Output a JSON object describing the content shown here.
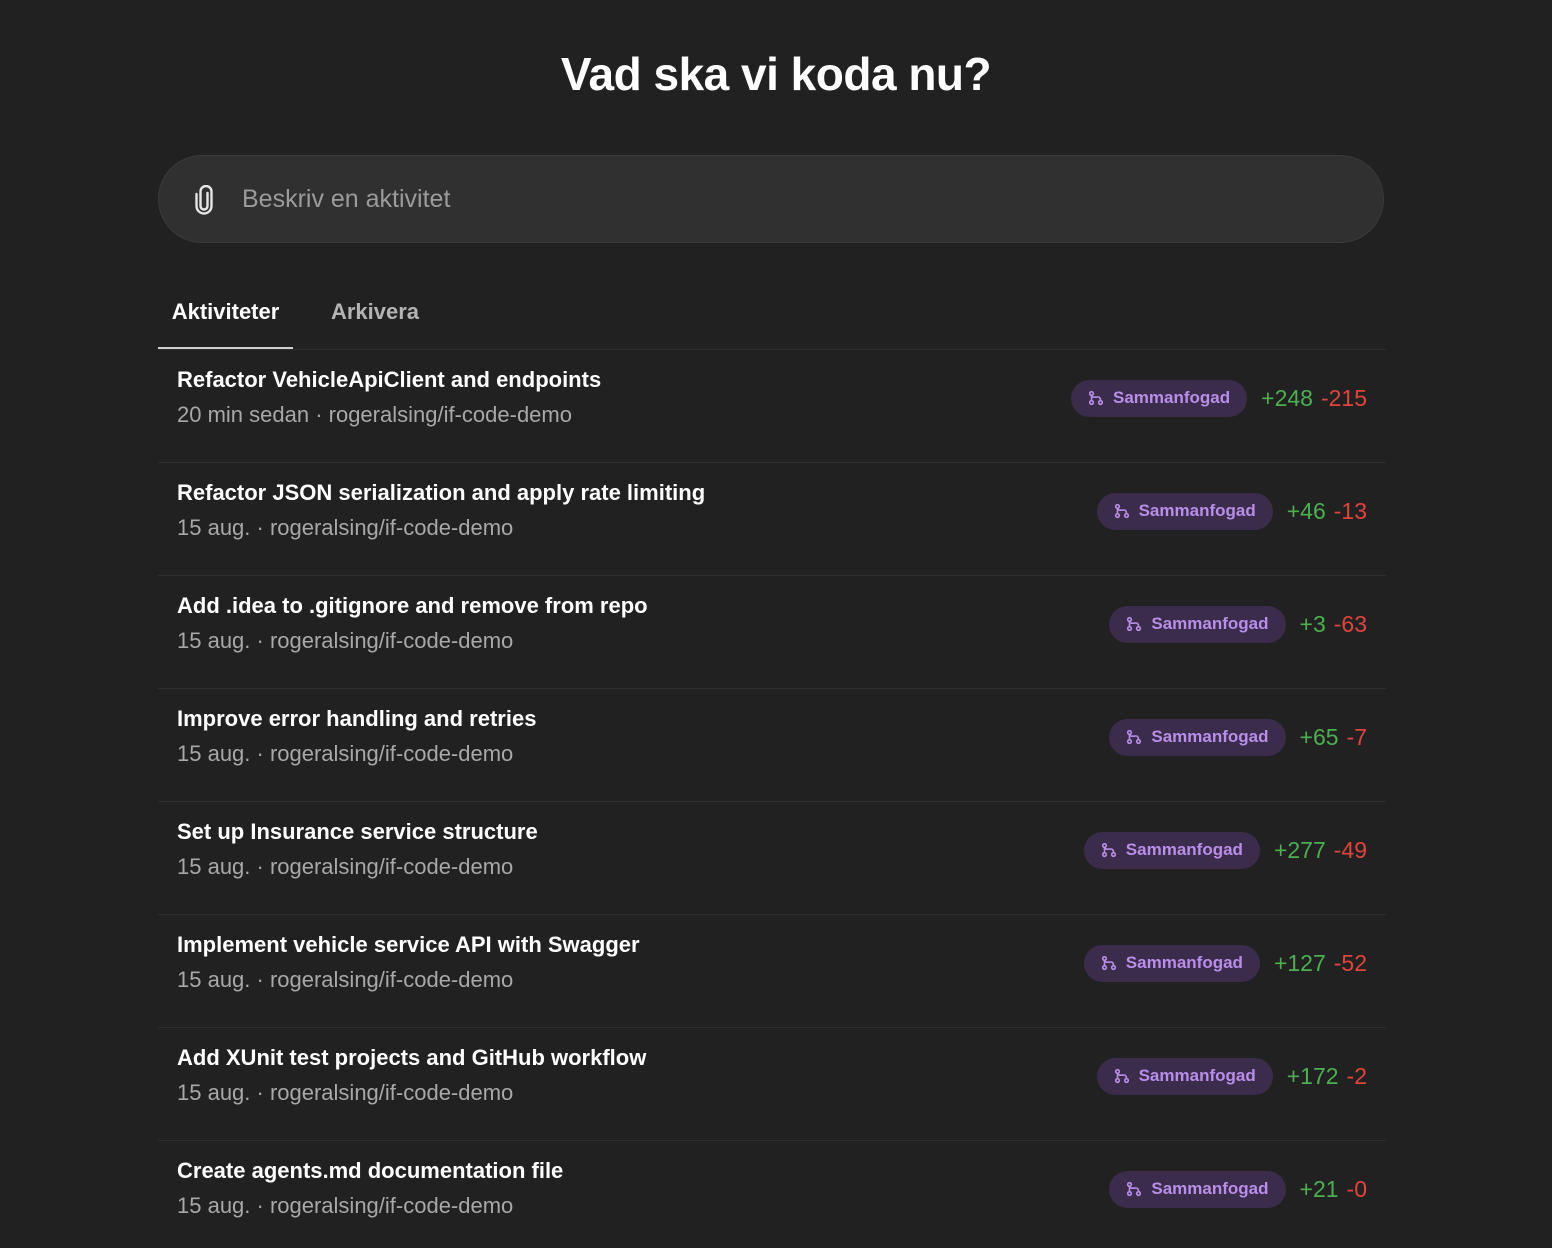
{
  "heading": "Vad ska vi koda nu?",
  "composer": {
    "placeholder": "Beskriv en aktivitet"
  },
  "tabs": [
    {
      "label": "Aktiviteter",
      "active": true
    },
    {
      "label": "Arkivera",
      "active": false
    }
  ],
  "colors": {
    "background": "#212121",
    "badge_bg": "#3a2c4a",
    "badge_text": "#b98ee8",
    "added": "#4caf50",
    "removed": "#e0443e"
  },
  "tasks": [
    {
      "title": "Refactor VehicleApiClient and endpoints",
      "subtitle": "20 min sedan · rogeralsing/if-code-demo",
      "status": "Sammanfogad",
      "status_icon": "merge-icon",
      "added": "+248",
      "removed": "-215"
    },
    {
      "title": "Refactor JSON serialization and apply rate limiting",
      "subtitle": "15 aug. · rogeralsing/if-code-demo",
      "status": "Sammanfogad",
      "status_icon": "merge-icon",
      "added": "+46",
      "removed": "-13"
    },
    {
      "title": "Add .idea to .gitignore and remove from repo",
      "subtitle": "15 aug. · rogeralsing/if-code-demo",
      "status": "Sammanfogad",
      "status_icon": "merge-icon",
      "added": "+3",
      "removed": "-63"
    },
    {
      "title": "Improve error handling and retries",
      "subtitle": "15 aug. · rogeralsing/if-code-demo",
      "status": "Sammanfogad",
      "status_icon": "merge-icon",
      "added": "+65",
      "removed": "-7"
    },
    {
      "title": "Set up Insurance service structure",
      "subtitle": "15 aug. · rogeralsing/if-code-demo",
      "status": "Sammanfogad",
      "status_icon": "merge-icon",
      "added": "+277",
      "removed": "-49"
    },
    {
      "title": "Implement vehicle service API with Swagger",
      "subtitle": "15 aug. · rogeralsing/if-code-demo",
      "status": "Sammanfogad",
      "status_icon": "merge-icon",
      "added": "+127",
      "removed": "-52"
    },
    {
      "title": "Add XUnit test projects and GitHub workflow",
      "subtitle": "15 aug. · rogeralsing/if-code-demo",
      "status": "Sammanfogad",
      "status_icon": "merge-icon",
      "added": "+172",
      "removed": "-2"
    },
    {
      "title": "Create agents.md documentation file",
      "subtitle": "15 aug. · rogeralsing/if-code-demo",
      "status": "Sammanfogad",
      "status_icon": "merge-icon",
      "added": "+21",
      "removed": "-0"
    }
  ]
}
